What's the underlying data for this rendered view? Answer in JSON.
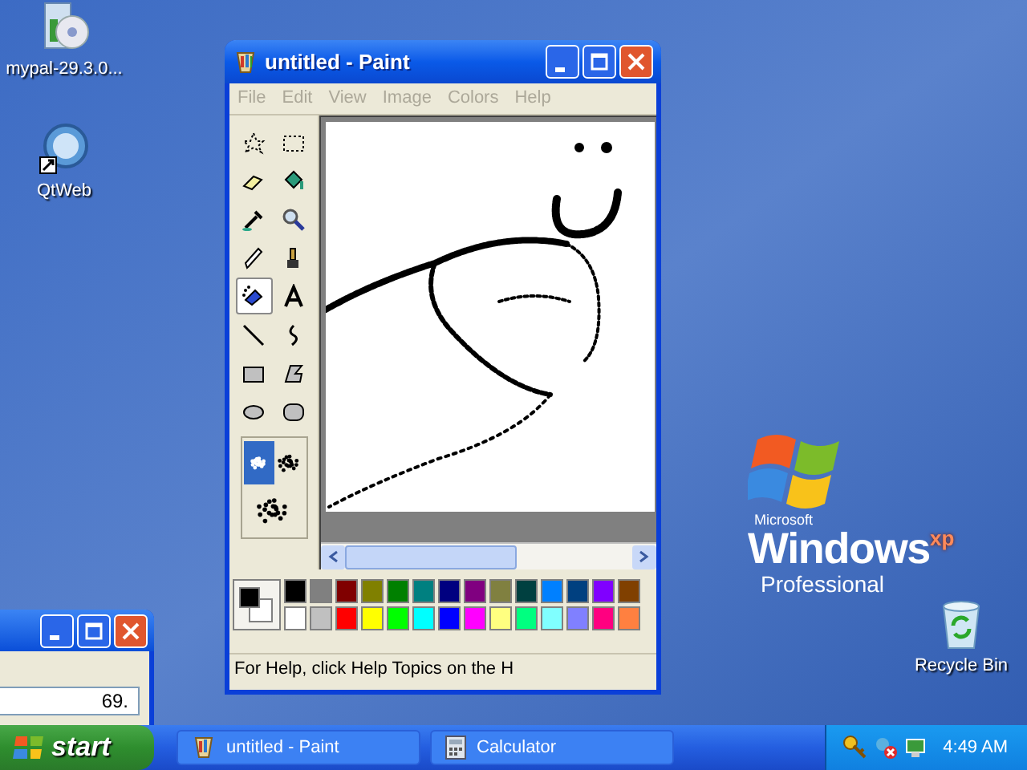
{
  "desktop_icons": [
    {
      "label": "mypal-29.3.0...",
      "kind": "installer"
    },
    {
      "label": "QtWeb",
      "kind": "shortcut"
    },
    {
      "label": "Recycle Bin",
      "kind": "bin"
    }
  ],
  "logo": {
    "brand": "Microsoft",
    "product": "Windows",
    "edition_mark": "xp",
    "edition": "Professional"
  },
  "paint": {
    "title": "untitled - Paint",
    "menu": [
      {
        "label": "File",
        "disabled": true
      },
      {
        "label": "Edit",
        "disabled": true
      },
      {
        "label": "View",
        "disabled": true
      },
      {
        "label": "Image",
        "disabled": true
      },
      {
        "label": "Colors",
        "disabled": true
      },
      {
        "label": "Help",
        "disabled": true
      }
    ],
    "tools": [
      {
        "selected": false
      },
      {
        "selected": false
      },
      {
        "selected": false
      },
      {
        "selected": false
      },
      {
        "selected": false
      },
      {
        "selected": false
      },
      {
        "selected": false
      },
      {
        "selected": false
      },
      {
        "selected": true
      },
      {
        "selected": false
      },
      {
        "selected": false
      },
      {
        "selected": false
      },
      {
        "selected": false
      },
      {
        "selected": false
      },
      {
        "selected": false
      },
      {
        "selected": false
      }
    ],
    "tool_options": [
      {
        "selected": true
      },
      {
        "selected": false
      },
      {
        "selected": false
      }
    ],
    "scrollbar": {
      "level": 0.6
    },
    "palette": [
      {
        "color": "#000000"
      },
      {
        "color": "#808080"
      },
      {
        "color": "#800000"
      },
      {
        "color": "#808000"
      },
      {
        "color": "#008000"
      },
      {
        "color": "#008080"
      },
      {
        "color": "#000080"
      },
      {
        "color": "#800080"
      },
      {
        "color": "#808040"
      },
      {
        "color": "#004040"
      },
      {
        "color": "#0080ff"
      },
      {
        "color": "#004080"
      },
      {
        "color": "#8000ff"
      },
      {
        "color": "#804000"
      },
      {
        "color": "#ffffff"
      },
      {
        "color": "#c0c0c0"
      },
      {
        "color": "#ff0000"
      },
      {
        "color": "#ffff00"
      },
      {
        "color": "#00ff00"
      },
      {
        "color": "#00ffff"
      },
      {
        "color": "#0000ff"
      },
      {
        "color": "#ff00ff"
      },
      {
        "color": "#ffff80"
      },
      {
        "color": "#00ff80"
      },
      {
        "color": "#80ffff"
      },
      {
        "color": "#8080ff"
      },
      {
        "color": "#ff0080"
      },
      {
        "color": "#ff8040"
      }
    ],
    "status": "For Help, click Help Topics on the H"
  },
  "calculator": {
    "display": "69."
  },
  "taskbar": {
    "start": "start",
    "tasks": [
      {
        "label": "untitled - Paint",
        "kind": "paint",
        "selected": false
      },
      {
        "label": "Calculator",
        "kind": "calculator",
        "selected": false
      }
    ],
    "clock": "4:49 AM"
  }
}
